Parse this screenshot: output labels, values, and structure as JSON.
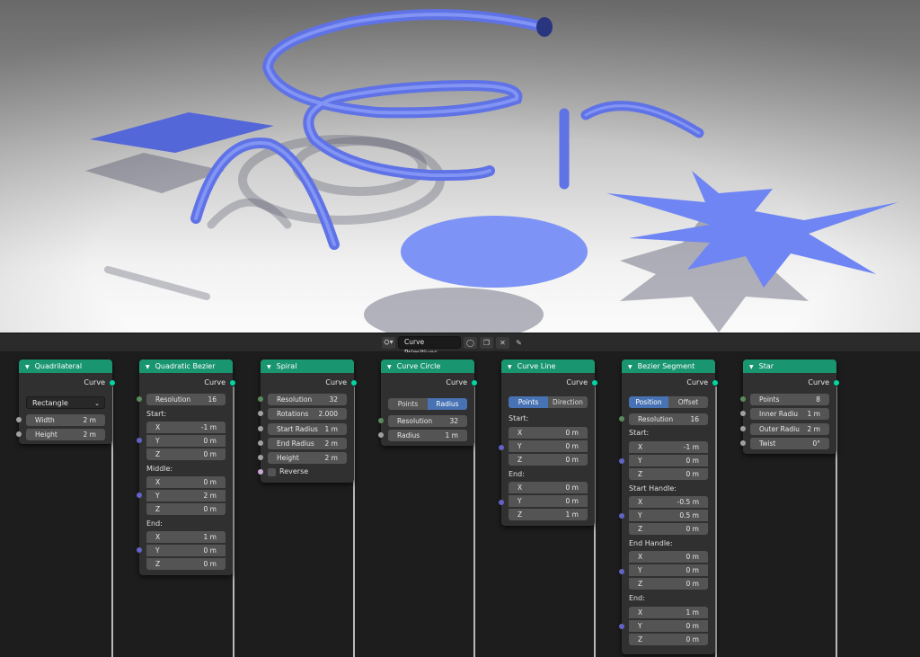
{
  "header": {
    "node_tree_name": "Curve Primitives",
    "icons": [
      "node-tree-icon",
      "fake-user-icon",
      "duplicate-icon",
      "close-icon",
      "pin-icon"
    ]
  },
  "socket_colors": {
    "geometry": "#00d6a3",
    "integer": "#598c5c",
    "float": "#a1a1a1",
    "vector": "#6363c7",
    "boolean": "#cca6d6"
  },
  "accent": {
    "node_header": "#19966f",
    "active_toggle": "#4772b3",
    "curve_color": "#6f82f5"
  },
  "nodes": {
    "quad": {
      "title": "Quadrilateral",
      "output": "Curve",
      "mode": "Rectangle",
      "width_label": "Width",
      "width_value": "2 m",
      "height_label": "Height",
      "height_value": "2 m"
    },
    "qbez": {
      "title": "Quadratic Bezier",
      "output": "Curve",
      "res_label": "Resolution",
      "res_value": "16",
      "start": "Start:",
      "middle": "Middle:",
      "end": "End:",
      "x": "X",
      "y": "Y",
      "z": "Z",
      "start_x": "-1 m",
      "start_y": "0 m",
      "start_z": "0 m",
      "mid_x": "0 m",
      "mid_y": "2 m",
      "mid_z": "0 m",
      "end_x": "1 m",
      "end_y": "0 m",
      "end_z": "0 m"
    },
    "spiral": {
      "title": "Spiral",
      "output": "Curve",
      "res_label": "Resolution",
      "res_value": "32",
      "rot_label": "Rotations",
      "rot_value": "2.000",
      "sr_label": "Start Radius",
      "sr_value": "1 m",
      "er_label": "End Radius",
      "er_value": "2 m",
      "h_label": "Height",
      "h_value": "2 m",
      "rev_label": "Reverse"
    },
    "circle": {
      "title": "Curve Circle",
      "output": "Curve",
      "mode_a": "Points",
      "mode_b": "Radius",
      "res_label": "Resolution",
      "res_value": "32",
      "rad_label": "Radius",
      "rad_value": "1 m"
    },
    "line": {
      "title": "Curve Line",
      "output": "Curve",
      "mode_a": "Points",
      "mode_b": "Direction",
      "start": "Start:",
      "end": "End:",
      "x": "X",
      "y": "Y",
      "z": "Z",
      "start_x": "0 m",
      "start_y": "0 m",
      "start_z": "0 m",
      "end_x": "0 m",
      "end_y": "0 m",
      "end_z": "1 m"
    },
    "bseg": {
      "title": "Bezier Segment",
      "output": "Curve",
      "mode_a": "Position",
      "mode_b": "Offset",
      "res_label": "Resolution",
      "res_value": "16",
      "start": "Start:",
      "sh": "Start Handle:",
      "eh": "End Handle:",
      "end": "End:",
      "x": "X",
      "y": "Y",
      "z": "Z",
      "start_x": "-1 m",
      "start_y": "0 m",
      "start_z": "0 m",
      "sh_x": "-0.5 m",
      "sh_y": "0.5 m",
      "sh_z": "0 m",
      "eh_x": "0 m",
      "eh_y": "0 m",
      "eh_z": "0 m",
      "end_x": "1 m",
      "end_y": "0 m",
      "end_z": "0 m"
    },
    "star": {
      "title": "Star",
      "output": "Curve",
      "pts_label": "Points",
      "pts_value": "8",
      "ir_label": "Inner Radiu",
      "ir_value": "1 m",
      "or_label": "Outer Radiu",
      "or_value": "2 m",
      "tw_label": "Twist",
      "tw_value": "0°"
    }
  }
}
